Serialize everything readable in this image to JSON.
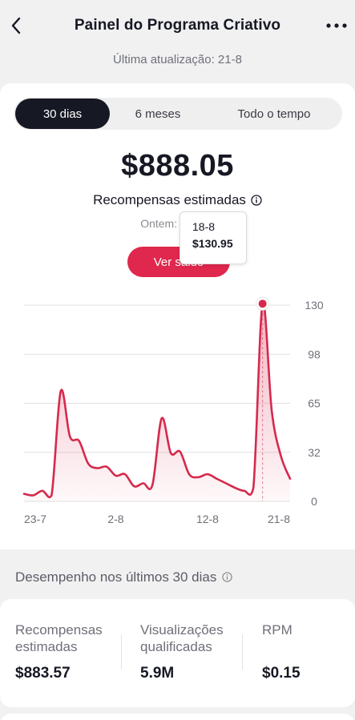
{
  "header": {
    "title": "Painel do Programa Criativo",
    "back_icon": "chevron-left-icon",
    "more_icon": "more-horizontal-icon"
  },
  "updated": "Última atualização: 21-8",
  "tabs": [
    {
      "label": "30 dias",
      "selected": true
    },
    {
      "label": "6 meses",
      "selected": false
    },
    {
      "label": "Todo o tempo",
      "selected": false
    }
  ],
  "summary": {
    "amount": "$888.05",
    "label": "Recompensas estimadas",
    "yesterday": "Ontem: $31.10",
    "button": "Ver saldo"
  },
  "tooltip": {
    "date": "18-8",
    "value": "$130.95"
  },
  "chart_data": {
    "type": "area",
    "color": "#d6294d",
    "x_tick_labels": [
      "23-7",
      "2-8",
      "12-8",
      "21-8"
    ],
    "y_tick_labels": [
      "130",
      "98",
      "65",
      "32",
      "0"
    ],
    "ylim": [
      0,
      130
    ],
    "grid": true,
    "highlight_index": 26,
    "x": [
      "23-7",
      "24-7",
      "25-7",
      "26-7",
      "27-7",
      "28-7",
      "29-7",
      "30-7",
      "31-7",
      "1-8",
      "2-8",
      "3-8",
      "4-8",
      "5-8",
      "6-8",
      "7-8",
      "8-8",
      "9-8",
      "10-8",
      "11-8",
      "12-8",
      "13-8",
      "14-8",
      "15-8",
      "16-8",
      "17-8",
      "18-8",
      "19-8",
      "20-8",
      "21-8"
    ],
    "values": [
      5,
      4,
      7,
      4,
      73,
      43,
      40,
      25,
      22,
      23,
      17,
      18,
      10,
      12,
      11,
      55,
      32,
      33,
      18,
      16,
      18,
      15,
      12,
      9,
      7,
      9,
      130.95,
      60,
      30,
      15
    ]
  },
  "performance": {
    "heading": "Desempenho nos últimos 30 dias",
    "stats": [
      {
        "label_line1": "Recompensas",
        "label_line2": "estimadas",
        "value": "$883.57"
      },
      {
        "label_line1": "Visualizações",
        "label_line2": "qualificadas",
        "value": "5.9M"
      },
      {
        "label_line1": "RPM",
        "label_line2": "",
        "value": "$0.15"
      }
    ]
  }
}
